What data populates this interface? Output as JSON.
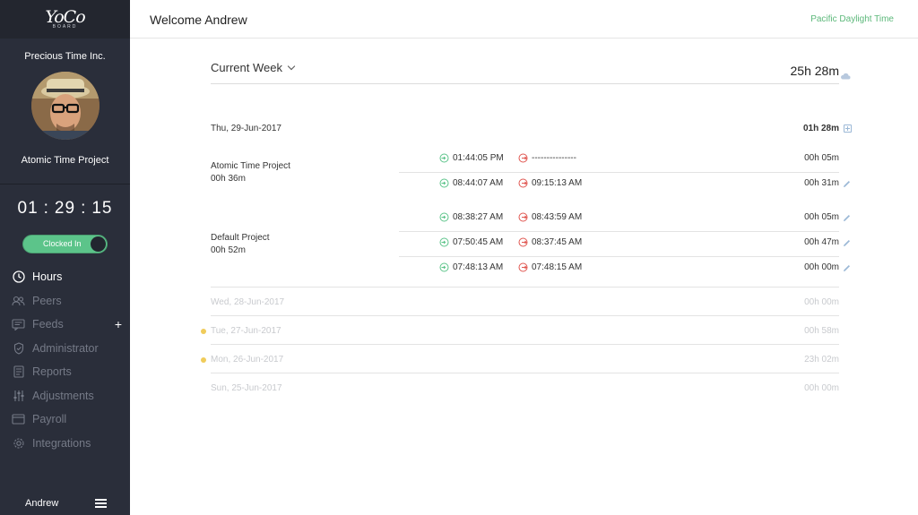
{
  "brand": {
    "logo_main": "YoCo",
    "logo_sub": "BOARD"
  },
  "sidebar": {
    "company": "Precious Time Inc.",
    "project": "Atomic Time Project",
    "timer": {
      "hours": "01",
      "minutes": "29",
      "seconds": "15"
    },
    "clock_status": "Clocked In",
    "nav": [
      {
        "label": "Hours",
        "icon": "clock-icon",
        "active": true
      },
      {
        "label": "Peers",
        "icon": "peers-icon"
      },
      {
        "label": "Feeds",
        "icon": "feeds-icon"
      },
      {
        "label": "Administrator",
        "icon": "shield-icon"
      },
      {
        "label": "Reports",
        "icon": "reports-icon"
      },
      {
        "label": "Adjustments",
        "icon": "sliders-icon"
      },
      {
        "label": "Payroll",
        "icon": "card-icon"
      },
      {
        "label": "Integrations",
        "icon": "gear-icon"
      }
    ],
    "user": "Andrew"
  },
  "header": {
    "welcome": "Welcome Andrew",
    "timezone": "Pacific Daylight Time"
  },
  "week": {
    "label": "Current Week",
    "total": "25h 28m"
  },
  "today": {
    "date": "Thu, 29-Jun-2017",
    "total": "01h 28m",
    "projects": [
      {
        "name": "Atomic Time Project",
        "total": "00h 36m",
        "entries": [
          {
            "in": "01:44:05 PM",
            "out": "---------------",
            "duration": "00h 05m",
            "editable": false
          },
          {
            "in": "08:44:07 AM",
            "out": "09:15:13 AM",
            "duration": "00h 31m",
            "editable": true
          }
        ]
      },
      {
        "name": "Default Project",
        "total": "00h 52m",
        "entries": [
          {
            "in": "08:38:27 AM",
            "out": "08:43:59 AM",
            "duration": "00h 05m",
            "editable": true
          },
          {
            "in": "07:50:45 AM",
            "out": "08:37:45 AM",
            "duration": "00h 47m",
            "editable": true
          },
          {
            "in": "07:48:13 AM",
            "out": "07:48:15 AM",
            "duration": "00h 00m",
            "editable": true
          }
        ]
      }
    ]
  },
  "past_days": [
    {
      "date": "Wed, 28-Jun-2017",
      "total": "00h 00m",
      "flag": false
    },
    {
      "date": "Tue, 27-Jun-2017",
      "total": "00h 58m",
      "flag": true
    },
    {
      "date": "Mon, 26-Jun-2017",
      "total": "23h 02m",
      "flag": true
    },
    {
      "date": "Sun, 25-Jun-2017",
      "total": "00h 00m",
      "flag": false
    }
  ],
  "colors": {
    "sidebar": "#2a2e3a",
    "accent_green": "#5cc48a",
    "clock_out_red": "#e0554f",
    "flag_yellow": "#f0cc5b"
  }
}
